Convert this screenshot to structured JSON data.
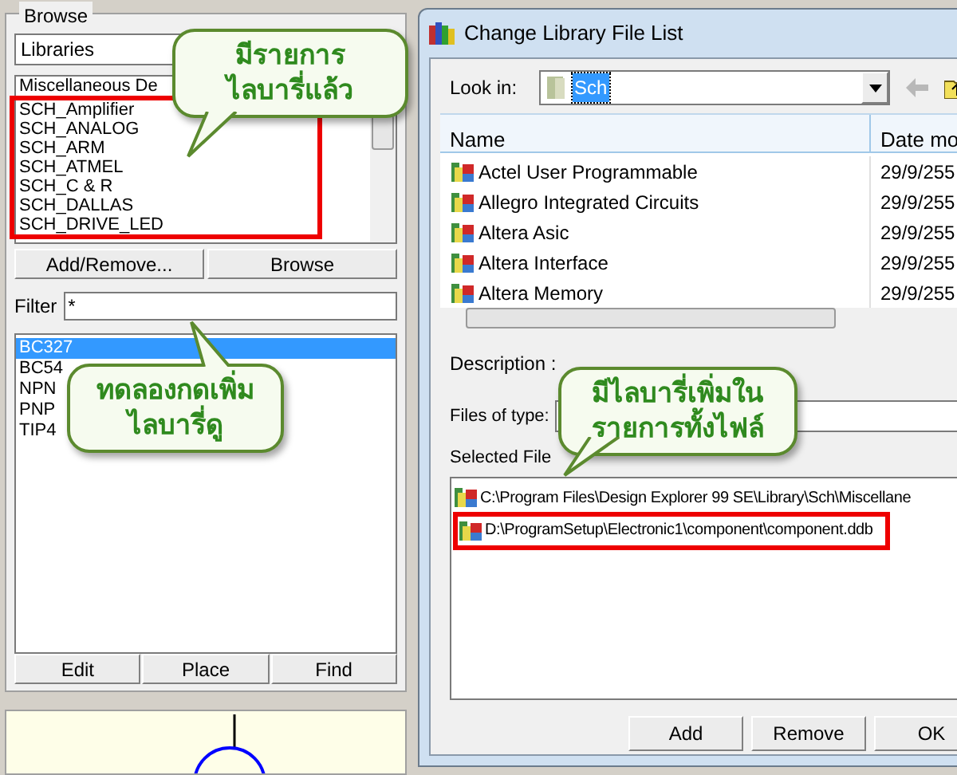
{
  "browse_panel": {
    "title": "Browse",
    "library_dropdown": "Libraries",
    "libraries": [
      {
        "name": "Miscellaneous De",
        "selected": false
      },
      {
        "name": "SCH_Amplifier",
        "selected": false
      },
      {
        "name": "SCH_ANALOG",
        "selected": false
      },
      {
        "name": "SCH_ARM",
        "selected": false
      },
      {
        "name": "SCH_ATMEL",
        "selected": false
      },
      {
        "name": "SCH_C & R",
        "selected": false
      },
      {
        "name": "SCH_DALLAS",
        "selected": false
      },
      {
        "name": "SCH_DRIVE_LED",
        "selected": false
      }
    ],
    "buttons": [
      "Add/Remove...",
      "Browse"
    ],
    "filter": {
      "label": "Filter",
      "value": "*"
    },
    "components": [
      {
        "name": "BC327",
        "selected": true
      },
      {
        "name": "BC54",
        "selected": false
      },
      {
        "name": "NPN",
        "selected": false
      },
      {
        "name": "PNP",
        "selected": false
      },
      {
        "name": "TIP4",
        "selected": false
      }
    ],
    "actions": [
      "Edit",
      "Place",
      "Find"
    ]
  },
  "dialog": {
    "title": "Change Library File List",
    "look_in": {
      "label": "Look in:",
      "value": "Sch"
    },
    "columns": [
      "Name",
      "Date mo"
    ],
    "files": [
      {
        "name": "Actel User Programmable",
        "date": "29/9/255"
      },
      {
        "name": "Allegro Integrated Circuits",
        "date": "29/9/255"
      },
      {
        "name": "Altera Asic",
        "date": "29/9/255"
      },
      {
        "name": "Altera Interface",
        "date": "29/9/255"
      },
      {
        "name": "Altera Memory",
        "date": "29/9/255"
      }
    ],
    "description_label": "Description :",
    "files_of_type_label": "Files of type:",
    "selected_files_label": "Selected File",
    "selected_files": [
      "C:\\Program Files\\Design Explorer 99 SE\\Library\\Sch\\Miscellane",
      "D:\\ProgramSetup\\Electronic1\\component\\component.ddb"
    ],
    "buttons": [
      "Add",
      "Remove",
      "OK"
    ]
  },
  "callouts": [
    {
      "lines": [
        "มีรายการ",
        "ไลบารี่แล้ว"
      ]
    },
    {
      "lines": [
        "ทดลองกดเพิ่ม",
        "ไลบารี่ดู"
      ]
    },
    {
      "lines": [
        "มีไลบารี่เพิ่มใน",
        "รายการทั้งไฟล์"
      ]
    }
  ]
}
